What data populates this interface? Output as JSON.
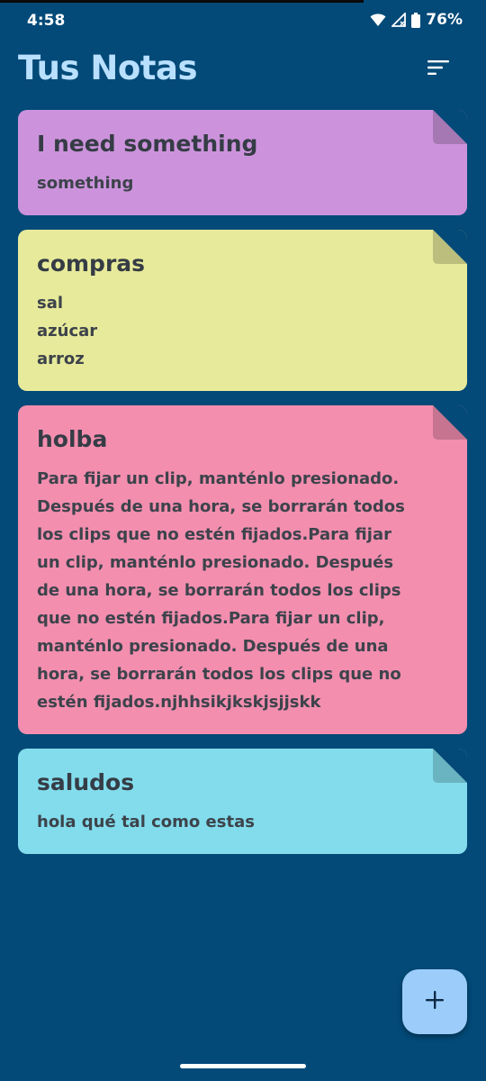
{
  "status_bar": {
    "time": "4:58",
    "battery": "76%"
  },
  "app": {
    "title": "Tus Notas"
  },
  "notes": [
    {
      "title": "I need something",
      "body": "something",
      "color": "#cc93dc",
      "fold_color": "#a678b3"
    },
    {
      "title": "compras",
      "body": "sal\nazúcar\narroz",
      "color": "#e7ea9a",
      "fold_color": "#bcbe7d"
    },
    {
      "title": "holba",
      "body": "Para fijar un clip, manténlo presionado. Después de una hora, se borrarán todos los clips que no estén fijados.Para fijar un clip, manténlo presionado. Después de una hora, se borrarán todos los clips que no estén fijados.Para fijar un clip, manténlo presionado. Después de una hora, se borrarán todos los clips que no estén fijados.njhhsikjkskjsjjskk",
      "color": "#f38eaf",
      "fold_color": "#c6748f"
    },
    {
      "title": "saludos",
      "body": "hola qué tal como estas",
      "color": "#82dcec",
      "fold_color": "#6ab3c0"
    }
  ],
  "icons": {
    "sort": "sort-icon",
    "add": "plus-icon",
    "wifi": "wifi-icon",
    "signal": "signal-icon",
    "battery": "battery-icon"
  }
}
